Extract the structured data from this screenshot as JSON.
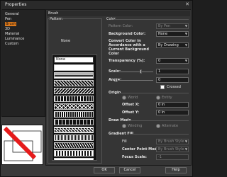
{
  "window": {
    "title": "Properties",
    "close_glyph": "✕"
  },
  "nav": {
    "items": [
      {
        "label": "General"
      },
      {
        "label": "Pen"
      },
      {
        "label": "Brush"
      },
      {
        "label": "3D"
      },
      {
        "label": "Material"
      },
      {
        "label": "Luminance"
      },
      {
        "label": "Custom"
      }
    ],
    "selected": "Brush"
  },
  "panel": {
    "title": "Brush",
    "pattern": {
      "group_label": "Pattern",
      "none_label": "None",
      "list_first": "None"
    },
    "color": {
      "group_label": "Color",
      "pattern_color_label": "Pattern Color:",
      "pattern_color_value": "By Pen",
      "background_color_label": "Background Color:",
      "background_color_value": "None",
      "convert_label": "Convert Color in Accordance with a Current Background Color",
      "convert_value": "By Drawing",
      "transparency_label": "Transparency (%):",
      "transparency_value": "0",
      "scale_label": "Scale:",
      "scale_value": "1",
      "angle_label": "Angle:",
      "angle_value": "0",
      "crossed_label": "Crossed"
    },
    "origin": {
      "label": "Origin",
      "world_label": "World",
      "entity_label": "Entity",
      "offset_x_label": "Offset X:",
      "offset_x_value": "0 in",
      "offset_y_label": "Offset Y:",
      "offset_y_value": "0 in"
    },
    "draw_mode": {
      "label": "Draw Mode",
      "winding_label": "Winding",
      "alternate_label": "Alternate"
    },
    "gradient": {
      "label": "Gradient Fill",
      "fill_label": "Fill",
      "fill_value": "By Brush Style",
      "center_point_label": "Center Point Mode:",
      "center_point_value": "By Brush Style",
      "focus_scale_label": "Focus Scale:",
      "focus_scale_value": "-1"
    }
  },
  "buttons": {
    "ok": "OK",
    "cancel": "Cancel",
    "help": "Help"
  }
}
